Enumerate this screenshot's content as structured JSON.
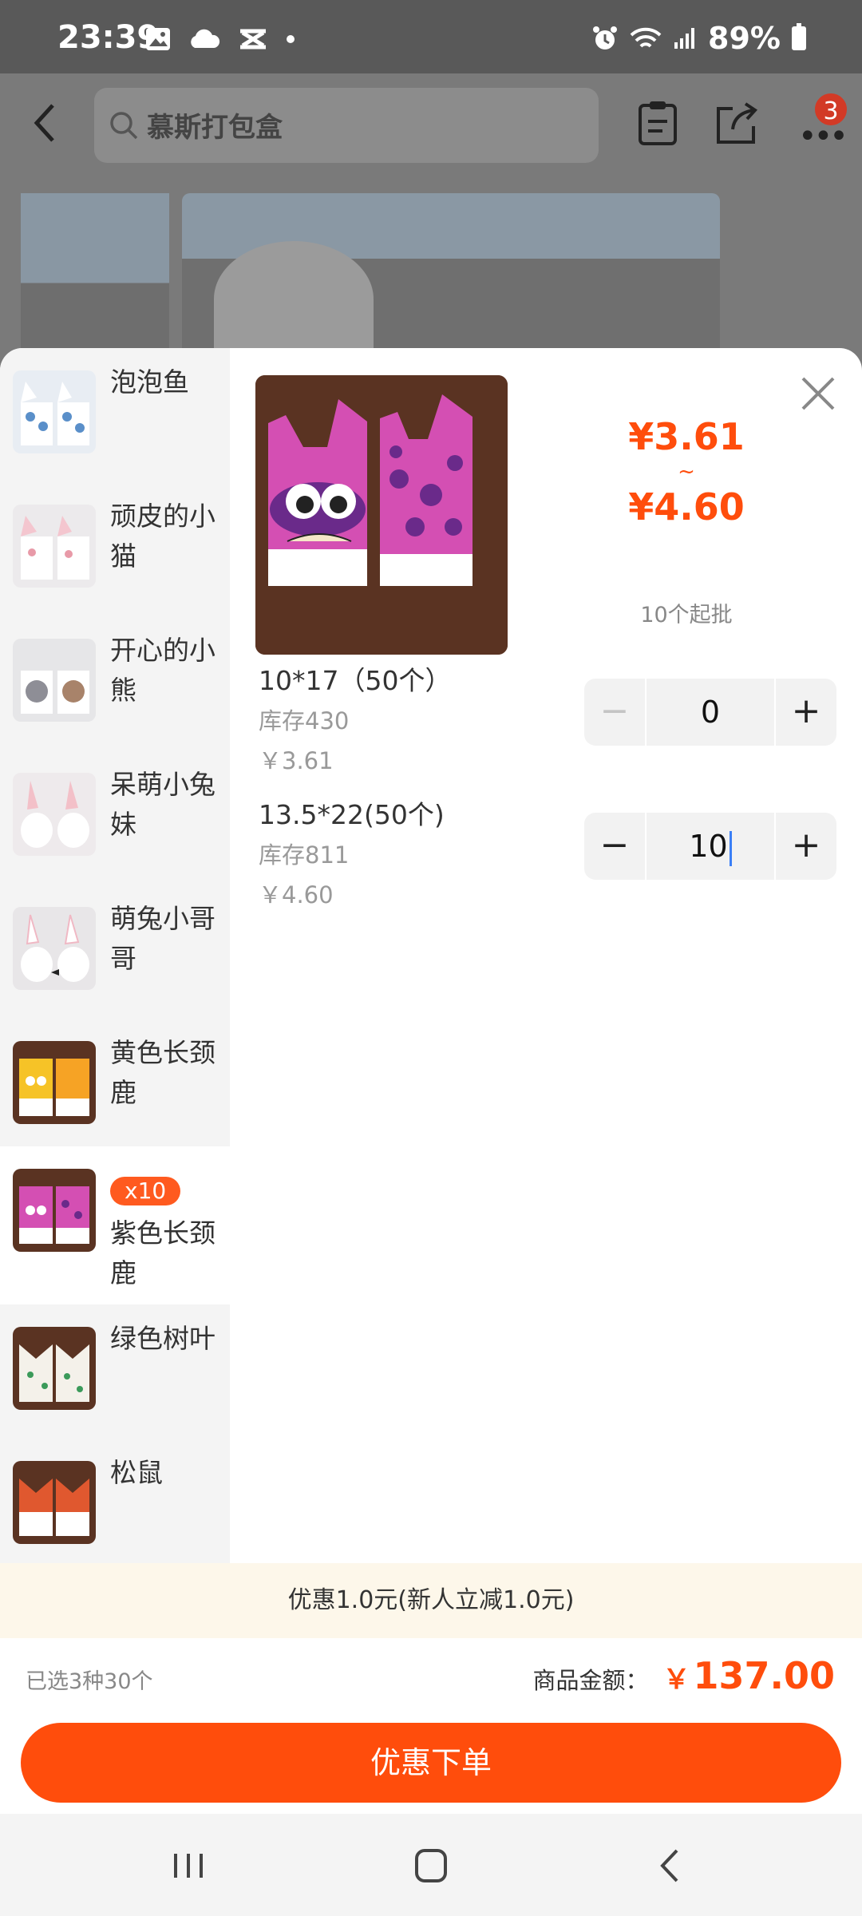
{
  "status_bar": {
    "time": "23:39",
    "battery": "89%"
  },
  "header": {
    "search_text": "慕斯打包盒",
    "cart_count": "3"
  },
  "variants": [
    {
      "name": "泡泡鱼",
      "thumb": "cat-blue"
    },
    {
      "name": "顽皮的小猫",
      "thumb": "cat-pink"
    },
    {
      "name": "开心的小熊",
      "thumb": "bear"
    },
    {
      "name": "呆萌小兔妹",
      "thumb": "bunny-girl"
    },
    {
      "name": "萌兔小哥哥",
      "thumb": "bunny-boy"
    },
    {
      "name": "黄色长颈鹿",
      "thumb": "giraffe-yellow"
    },
    {
      "name": "紫色长颈鹿",
      "thumb": "giraffe-purple",
      "badge": "x10",
      "selected": true
    },
    {
      "name": "绿色树叶",
      "thumb": "leaf-green"
    },
    {
      "name": "松鼠",
      "thumb": "squirrel"
    }
  ],
  "product": {
    "price_low": "¥3.61",
    "price_tilde": "~",
    "price_high": "¥4.60",
    "min_order": "10个起批"
  },
  "skus": [
    {
      "name": "10*17（50个）",
      "stock": "库存430",
      "price": "￥3.61",
      "qty": "0",
      "minus_disabled": true
    },
    {
      "name": "13.5*22(50个)",
      "stock": "库存811",
      "price": "￥4.60",
      "qty": "10",
      "minus_disabled": false
    }
  ],
  "promo": {
    "text": "优惠1.0元(新人立减1.0元)"
  },
  "summary": {
    "selected": "已选3种30个",
    "total_label": "商品金额：",
    "total_symbol": "￥",
    "total_value": "137.00"
  },
  "order_button": {
    "label": "优惠下单"
  },
  "colors": {
    "accent": "#ff4d0c",
    "badge": "#ff5a1f",
    "promo_bg": "#fdf7ea"
  }
}
